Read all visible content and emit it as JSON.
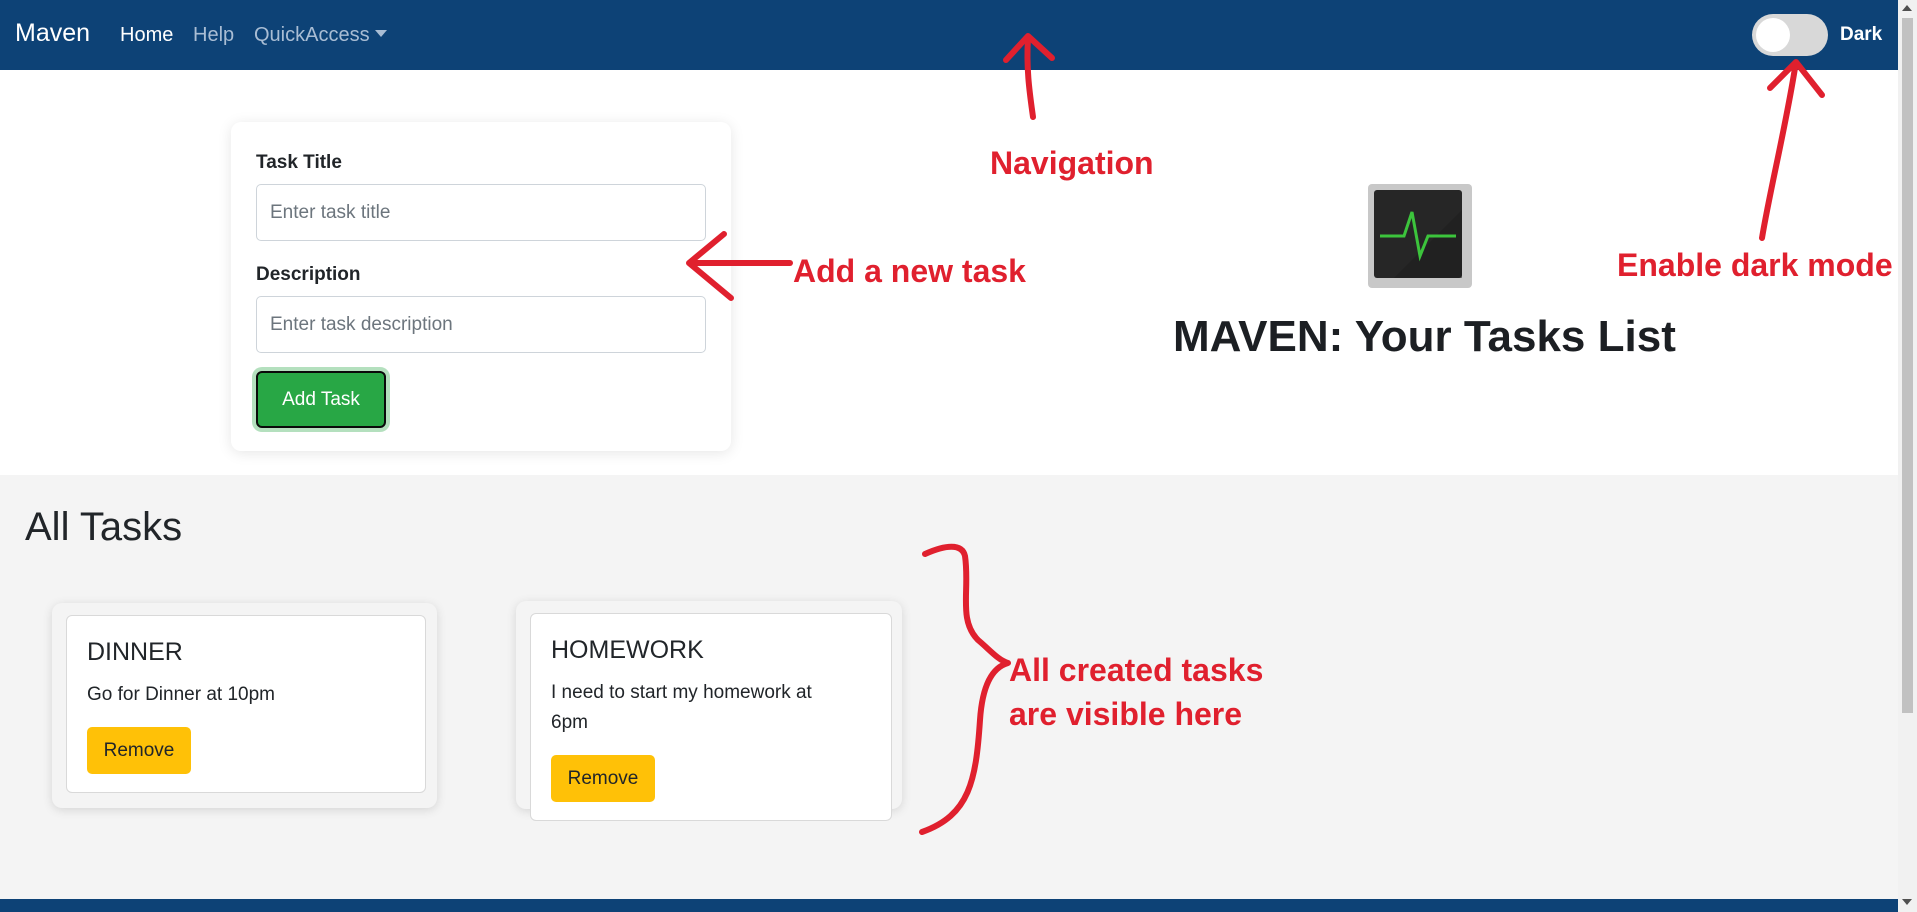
{
  "navbar": {
    "brand": "Maven",
    "links": [
      {
        "label": "Home",
        "active": true
      },
      {
        "label": "Help",
        "active": false
      },
      {
        "label": "QuickAccess",
        "active": false,
        "dropdown": true
      }
    ],
    "dark_toggle": {
      "label": "Dark",
      "on": false
    }
  },
  "form": {
    "title_label": "Task Title",
    "title_placeholder": "Enter task title",
    "title_value": "",
    "description_label": "Description",
    "description_placeholder": "Enter task description",
    "description_value": "",
    "submit_label": "Add Task"
  },
  "hero": {
    "icon": "activity-monitor-icon",
    "title": "MAVEN: Your Tasks List"
  },
  "tasks_section": {
    "title": "All Tasks",
    "tasks": [
      {
        "title": "DINNER",
        "description": "Go for Dinner at 10pm",
        "remove_label": "Remove"
      },
      {
        "title": "HOMEWORK",
        "description": "I need to start my homework at 6pm",
        "remove_label": "Remove"
      }
    ]
  },
  "annotations": {
    "navigation": "Navigation",
    "add_task": "Add a new task",
    "dark_mode": "Enable dark mode",
    "visible_tasks_line1": "All created tasks",
    "visible_tasks_line2": "are visible here"
  },
  "colors": {
    "navbar": "#0d4276",
    "add_button": "#28a745",
    "remove_button": "#ffc107",
    "annotation": "#e0202e",
    "section_bg": "#f4f4f4"
  }
}
